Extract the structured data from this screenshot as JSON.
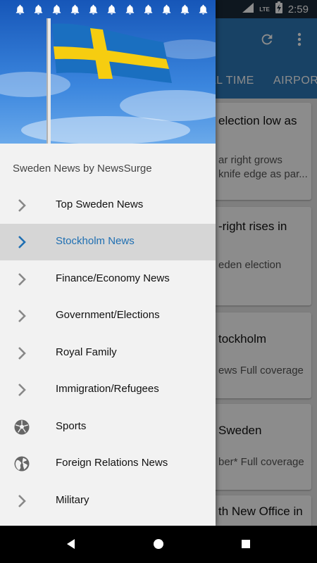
{
  "status_bar": {
    "time": "2:59",
    "network": "LTE",
    "notification_count": 11
  },
  "background": {
    "tabs": [
      "AL TIME",
      "AIRPORT"
    ],
    "cards": [
      {
        "title": "election low as",
        "subtitle": "ar right grows\nknife edge as par..."
      },
      {
        "title": "-right rises in",
        "subtitle": "eden election"
      },
      {
        "title": "tockholm",
        "subtitle": "ews  Full coverage"
      },
      {
        "title": "Sweden",
        "subtitle": "ber*  Full coverage"
      },
      {
        "title": "th New Office in",
        "subtitle": ""
      }
    ]
  },
  "drawer": {
    "caption": "Sweden News by NewsSurge",
    "items": [
      {
        "label": "Top Sweden News",
        "icon": "chevron-right-icon"
      },
      {
        "label": "Stockholm News",
        "icon": "chevron-right-icon",
        "selected": true
      },
      {
        "label": "Finance/Economy News",
        "icon": "chevron-right-icon"
      },
      {
        "label": "Government/Elections",
        "icon": "chevron-right-icon"
      },
      {
        "label": "Royal Family",
        "icon": "chevron-right-icon"
      },
      {
        "label": "Immigration/Refugees",
        "icon": "chevron-right-icon"
      },
      {
        "label": "Sports",
        "icon": "soccer-ball-icon"
      },
      {
        "label": "Foreign Relations News",
        "icon": "globe-icon"
      },
      {
        "label": "Military",
        "icon": "chevron-right-icon"
      }
    ]
  },
  "colors": {
    "accent": "#1f6fb2",
    "toolbar": "#2c79b8",
    "selected_bg": "#d6d6d6"
  }
}
